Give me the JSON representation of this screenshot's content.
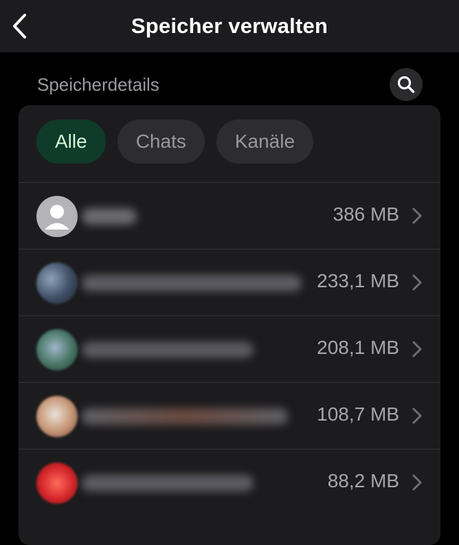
{
  "header": {
    "title": "Speicher verwalten"
  },
  "section": {
    "label": "Speicherdetails"
  },
  "filters": [
    {
      "label": "Alle",
      "active": true
    },
    {
      "label": "Chats",
      "active": false
    },
    {
      "label": "Kanäle",
      "active": false
    }
  ],
  "chats": [
    {
      "size": "386 MB"
    },
    {
      "size": "233,1 MB"
    },
    {
      "size": "208,1 MB"
    },
    {
      "size": "108,7 MB"
    },
    {
      "size": "88,2 MB"
    }
  ],
  "icons": {
    "back": "chevron-left-icon",
    "search": "search-icon",
    "row_arrow": "chevron-right-icon",
    "default_avatar": "person-icon"
  },
  "colors": {
    "header_bg": "#1c1c1e",
    "card_bg": "#1c1c1e",
    "active_chip_bg": "#0f3b2a",
    "active_chip_text": "#d5f5d8"
  }
}
